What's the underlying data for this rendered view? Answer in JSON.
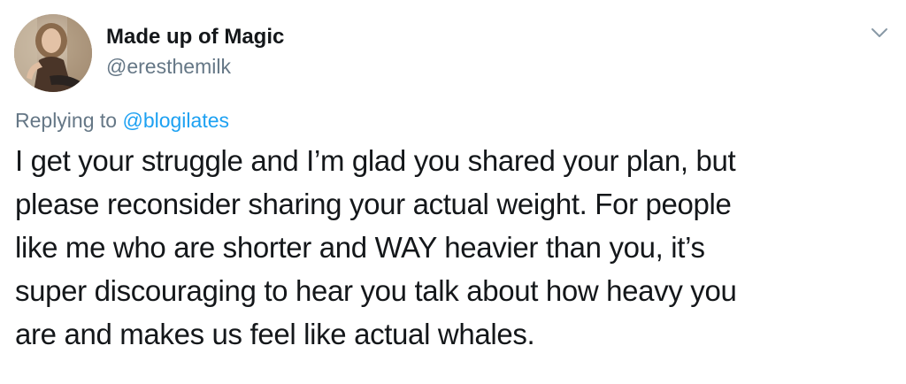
{
  "tweet": {
    "author": {
      "display_name": "Made up of Magic",
      "handle": "@eresthemilk"
    },
    "reply_context": {
      "prefix": "Replying to",
      "mention": "@blogilates"
    },
    "text_lines": [
      "I get your struggle and I’m glad you shared your plan, but",
      "please reconsider sharing your actual weight. For people",
      "like me who are shorter and WAY heavier than you, it’s",
      "super discouraging to hear you talk about how heavy you",
      "are and makes us feel like actual whales."
    ],
    "icons": {
      "more": "chevron-down-icon",
      "avatar": "profile-photo"
    },
    "colors": {
      "link": "#1da1f2",
      "secondary_text": "#657786",
      "primary_text": "#14171a"
    }
  }
}
